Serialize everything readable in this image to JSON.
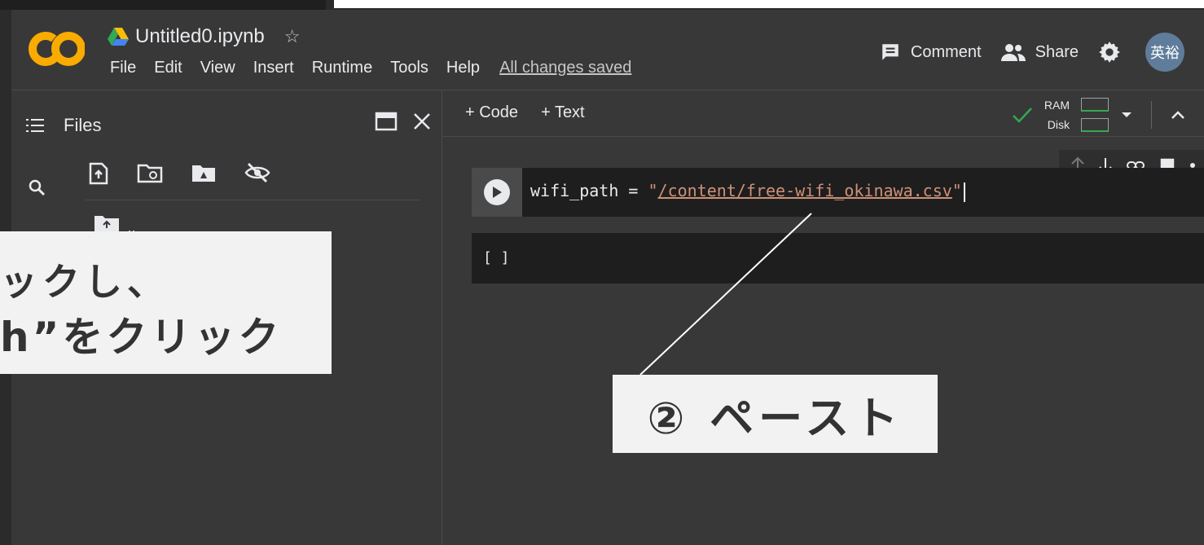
{
  "app": {
    "logo_text": "CO",
    "title": "Untitled0.ipynb"
  },
  "menu": {
    "items": [
      "File",
      "Edit",
      "View",
      "Insert",
      "Runtime",
      "Tools",
      "Help"
    ],
    "status": "All changes saved"
  },
  "header_actions": {
    "comment": "Comment",
    "share": "Share",
    "avatar": "英裕"
  },
  "sidebar": {
    "title": "Files",
    "parent_folder_label": ".."
  },
  "toolbar": {
    "add_code": "+ Code",
    "add_text": "+ Text",
    "ram_label": "RAM",
    "disk_label": "Disk"
  },
  "cell": {
    "code_prefix": "wifi_path = ",
    "quote": "\"",
    "path": "/content/free-wifi_okinawa.csv",
    "output": "[ ]"
  },
  "annotations": {
    "left_line1": "ックし、",
    "left_line2": "h”をクリック",
    "paste": "② ペースト"
  },
  "colors": {
    "background": "#383838",
    "code_bg": "#1e1e1e",
    "string": "#ce9178",
    "logo_orange": "#f9ab00",
    "status_green": "#34a853"
  }
}
